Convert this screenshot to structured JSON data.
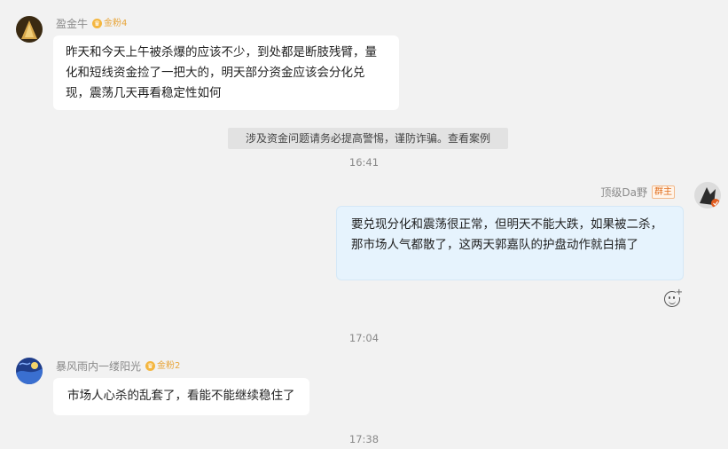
{
  "messages": [
    {
      "user": "盈金牛",
      "badge": "金粉4",
      "text": "昨天和今天上午被杀爆的应该不少，到处都是断肢残臂，量化和短线资金捡了一把大的，明天部分资金应该会分化兑现，震荡几天再看稳定性如何"
    },
    {
      "user": "顶级Da野",
      "badge": "群主",
      "text": "要兑现分化和震荡很正常，但明天不能大跌，如果被二杀，那市场人气都散了，这两天郭嘉队的护盘动作就白搞了"
    },
    {
      "user": "暴风雨内一缕阳光",
      "badge": "金粉2",
      "text": "市场人心杀的乱套了，看能不能继续稳住了"
    }
  ],
  "notice": {
    "text": "涉及资金问题请务必提高警惕，谨防诈骗。",
    "link": "查看案例"
  },
  "timestamps": [
    "16:41",
    "17:04",
    "17:38"
  ],
  "icons": {
    "fan_badge": "crown-icon",
    "add_reaction": "emoji-plus-icon"
  },
  "colors": {
    "background": "#f2f2f2",
    "my_bubble": "#e6f3fd",
    "fan_badge": "#e8a53a",
    "owner_badge": "#e06c1a"
  }
}
